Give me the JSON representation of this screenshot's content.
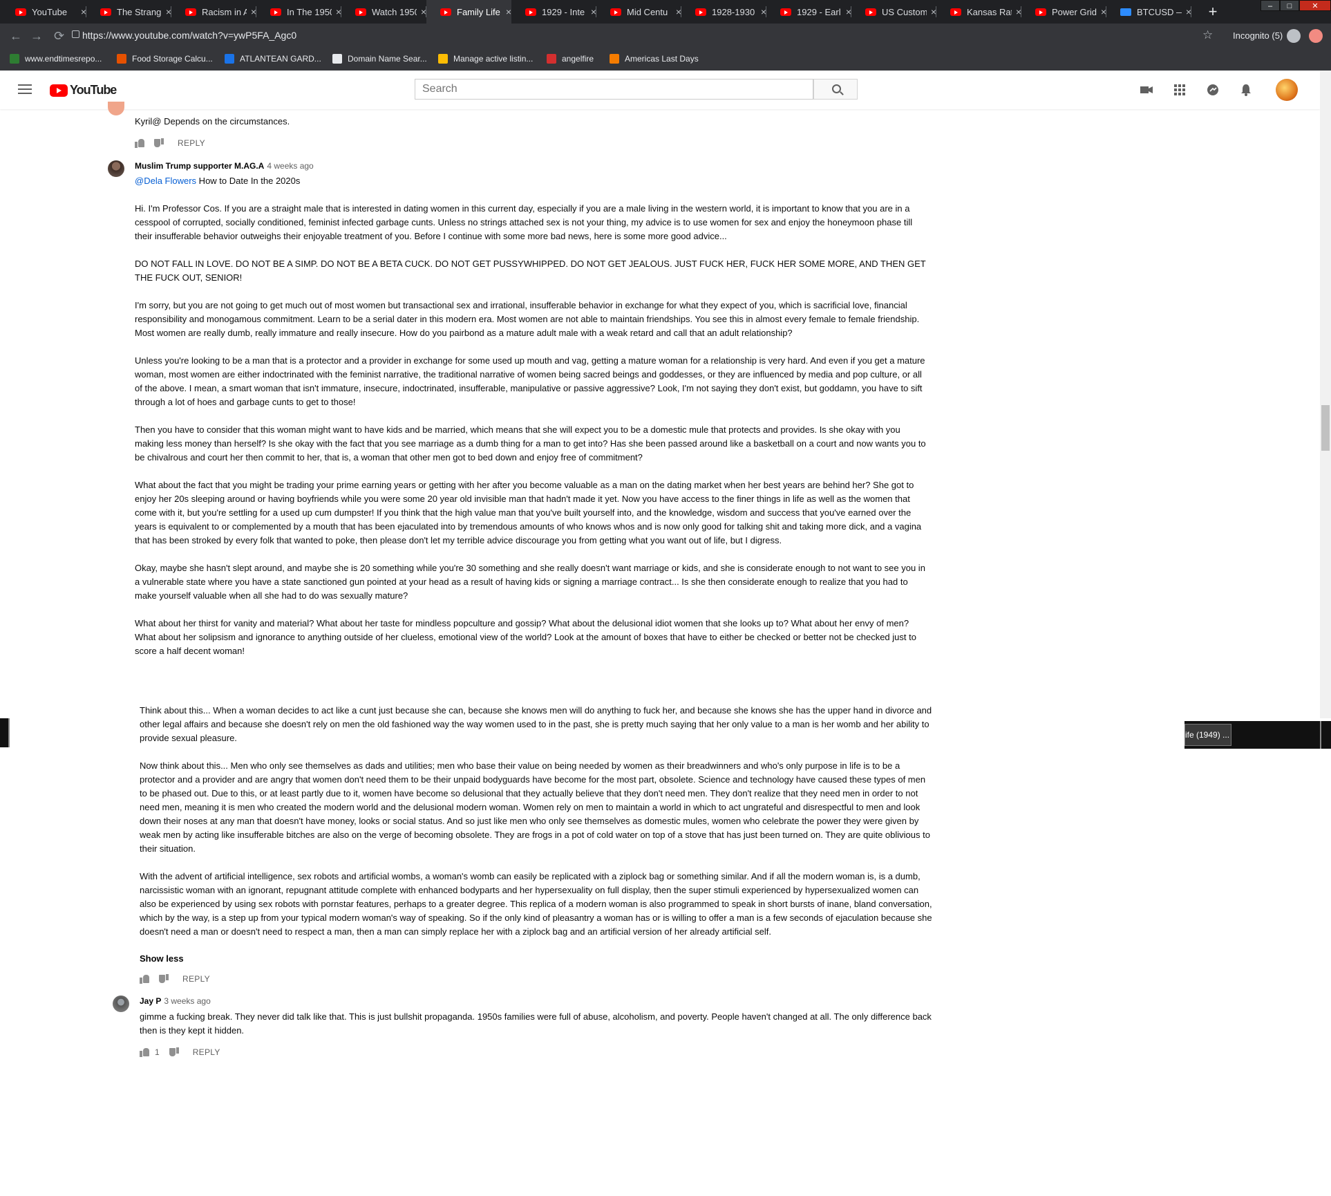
{
  "browser": {
    "tabs": [
      {
        "label": "YouTube",
        "active": false
      },
      {
        "label": "The Strange",
        "active": false
      },
      {
        "label": "Racism in A",
        "active": false
      },
      {
        "label": "In The 1950",
        "active": false
      },
      {
        "label": "Watch 1950",
        "active": false
      },
      {
        "label": "Family Life",
        "active": true
      },
      {
        "label": "1929 - Inte",
        "active": false
      },
      {
        "label": "Mid Centu",
        "active": false
      },
      {
        "label": "1928-1930",
        "active": false
      },
      {
        "label": "1929 - Earl",
        "active": false
      },
      {
        "label": "US Custom",
        "active": false
      },
      {
        "label": "Kansas Rat",
        "active": false
      },
      {
        "label": "Power Grid",
        "active": false
      },
      {
        "label": "BTCUSD —",
        "active": false
      }
    ],
    "tab_close": "×",
    "new_tab": "+",
    "window_controls": {
      "minimize": "–",
      "maximize": "□",
      "close": "✕"
    },
    "url": "https://www.youtube.com/watch?v=ywP5FA_Agc0",
    "incognito_label": "Incognito (5)",
    "bookmarks": [
      {
        "label": "www.endtimesrepo...",
        "color": "#2e7d32"
      },
      {
        "label": "Food Storage Calcu...",
        "color": "#e65100"
      },
      {
        "label": "ATLANTEAN GARD...",
        "color": "#1a73e8"
      },
      {
        "label": "Domain Name Sear...",
        "color": "#e8eaed"
      },
      {
        "label": "Manage active listin...",
        "color": "#fbbc04"
      },
      {
        "label": "angelfire",
        "color": "#d32f2f"
      },
      {
        "label": "Americas Last Days",
        "color": "#f57c00"
      }
    ]
  },
  "youtube": {
    "logo_text": "YouTube",
    "search_placeholder": "Search",
    "brand_color": "#ff0000"
  },
  "comments": {
    "top": {
      "text": "Kyril@ Depends on the circumstances.",
      "reply": "REPLY"
    },
    "main": {
      "author": "Muslim Trump supporter M.AG.A",
      "time": "4 weeks ago",
      "mention": "@Dela Flowers",
      "first_line": " How to Date In the 2020s",
      "paragraphs": [
        "Hi. I'm Professor Cos. If you are a straight male that is interested in dating women in this current day, especially if you are a male living in the western world, it is important to know that you are in a cesspool of corrupted, socially conditioned, feminist infected garbage cunts. Unless no strings attached sex is not your thing, my advice is to use women for sex and enjoy the honeymoon phase till their insufferable behavior outweighs their enjoyable treatment of you. Before I continue with some more bad news, here is some more good advice...",
        "DO NOT FALL IN LOVE. DO NOT BE A SIMP. DO NOT BE A BETA CUCK. DO NOT GET PUSSYWHIPPED. DO NOT GET JEALOUS. JUST FUCK HER, FUCK HER SOME MORE, AND THEN GET THE FUCK OUT, SENIOR!",
        "I'm sorry, but you are not going to get much out of most women but transactional sex and irrational, insufferable behavior in exchange for what they expect of you, which is sacrificial love, financial responsibility and monogamous commitment. Learn to be a serial dater in this modern era. Most women are not able to maintain friendships. You see this in almost every female to female friendship. Most women are really dumb, really immature and really insecure. How do you pairbond as a mature adult male with a weak retard and call that an adult relationship?",
        "Unless you're looking to be a man that is a protector and a provider in exchange for some used up mouth and vag, getting a mature woman for a relationship is very hard. And even if you get a mature woman, most women are either indoctrinated with the feminist narrative, the traditional narrative of women being sacred beings and goddesses, or they are influenced by media and pop culture, or all of the above. I mean, a smart woman that isn't immature, insecure, indoctrinated, insufferable, manipulative or passive aggressive? Look, I'm not saying they don't exist, but goddamn, you have to sift through a lot of hoes and garbage cunts to get to those!",
        "Then you have to consider that this woman might want to have kids and be married, which means that she will expect you to be a domestic mule that protects and provides. Is she okay with you making less money than herself? Is she okay with the fact that you see marriage as a dumb thing for a man to get into? Has she been passed around like a basketball on a court and now wants you to be chivalrous and court her then commit to her, that is, a woman that other men got to bed down and enjoy free of commitment?",
        "What about the fact that you might be trading your prime earning years or getting with her after you become valuable as a man on the dating market when her best years are behind her? She got to enjoy her 20s sleeping around or having boyfriends while you were some 20 year old invisible man that hadn't made it yet. Now you have access to the finer things in life as well as the women that come with it, but you're settling for a used up cum dumpster! If you think that the high value man that you've built yourself into, and the knowledge, wisdom and success that you've earned over the years is equivalent to or complemented by a mouth that has been ejaculated into by tremendous amounts of who knows whos and is now only good for talking shit and taking more dick, and a vagina that has been stroked by every folk that wanted to poke, then please don't let my terrible advice discourage you from getting what you want out of life, but I digress.",
        "Okay, maybe she hasn't slept around, and maybe she is 20 something while you're 30 something and she really doesn't want marriage or kids, and she is considerate enough to not want to see you in a vulnerable state where you have a state sanctioned gun pointed at your head as a result of having kids or signing a marriage contract... Is she then considerate enough to realize that you had to make yourself valuable when all she had to do was sexually mature?",
        "What about her thirst for vanity and material? What about her taste for mindless popculture and gossip? What about the delusional idiot women that she looks up to? What about her envy of men? What about her solipsism and ignorance to anything outside of her clueless, emotional view of the world? Look at the amount of boxes that have to either be checked or better not be checked just to score a half decent woman!"
      ],
      "reply": "REPLY"
    },
    "continued": {
      "paragraphs": [
        "Think about this... When a woman decides to act like a cunt just because she can, because she knows men will do anything to fuck her, and because she knows she has the upper hand in divorce and other legal affairs and because she doesn't rely on men the old fashioned way the way women used to in the past, she is pretty much saying that her only value to a man is her womb and her ability to provide sexual pleasure.",
        "Now think about this... Men who only see themselves as dads and utilities; men who base their value on being needed by women as their breadwinners and who's only purpose in life is to be a protector and a provider and are angry that women don't need them to be their unpaid bodyguards have become for the most part, obsolete. Science and technology have caused these types of men to be phased out. Due to this, or at least partly due to it, women have become so delusional that they actually believe that they don't need men. They don't realize that they need men in order to not need men, meaning it is men who created the modern world and the delusional modern woman. Women rely on men to maintain a world in which to act ungrateful and disrespectful to men and look down their noses at any man that doesn't have money, looks or social status. And so just like men who only see themselves as domestic mules, women who celebrate the power they were given by weak men by acting like insufferable bitches are also on the verge of becoming obsolete. They are frogs in a pot of cold water on top of a stove that has just been turned on. They are quite oblivious to their situation.",
        "With the advent of artificial intelligence, sex robots and artificial wombs, a woman's womb can easily be replicated with a ziplock bag or something similar. And if all the modern woman is, is a dumb, narcissistic woman with an ignorant, repugnant attitude complete with enhanced bodyparts and her hypersexuality on full display, then the super stimuli experienced by hypersexualized women can also be experienced by using sex robots with pornstar features, perhaps to a greater degree. This replica of a modern woman is also programmed to speak in short bursts of inane, bland conversation, which by the way, is a step up from your typical modern woman's way of speaking. So if the only kind of pleasantry a woman has or is willing to offer a man is a few seconds of ejaculation because she doesn't need a man or doesn't need to respect a man, then a man can simply replace her with a ziplock bag and an artificial version of her already artificial self."
      ],
      "show_less": "Show less",
      "reply": "REPLY"
    },
    "jay": {
      "author": "Jay P",
      "time": "3 weeks ago",
      "text": "gimme a fucking break. They never did talk like that. This is just bullshit propaganda. 1950s families were full of abuse, alcoholism, and poverty. People haven't changed at all. The only difference back then is they kept it hidden.",
      "likes": "1",
      "reply": "REPLY"
    }
  },
  "taskbar": {
    "item_label": "ife (1949) ..."
  }
}
